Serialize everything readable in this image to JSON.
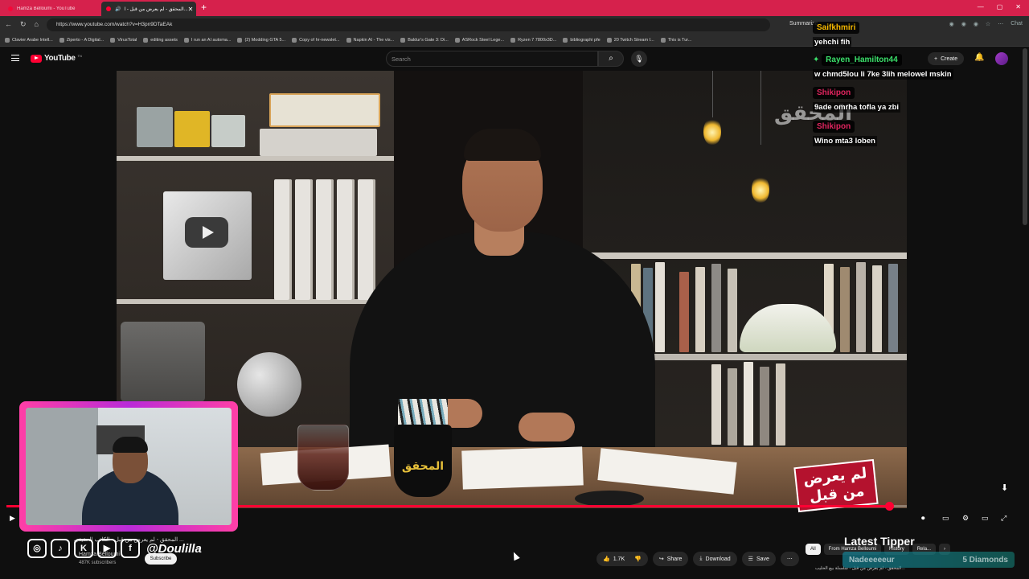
{
  "browser": {
    "tabs": [
      {
        "label": "Hamza Belloumi - YouTube",
        "active": false
      },
      {
        "label": "المحقق - لم يعرض من قبل - ا...",
        "active": true
      }
    ],
    "url": "https://www.youtube.com/watch?v=H3pn9DTaEAk",
    "summarize_label": "Summarize",
    "chat_label": "Chat",
    "bookmarks": [
      "Clavier Arabe Intell...",
      "Ziperto - A Digital...",
      "VirusTotal",
      "editing assets",
      "I run an AI automa...",
      "(2) Modding GTA 5...",
      "Copy of hr-newslet...",
      "Napkin AI - The vis...",
      "Baldur's Gate 3: Di...",
      "ASRock Steel Lege...",
      "Ryzen 7 7800x3D...",
      "bibliographi pfe",
      "20 Twitch Stream I...",
      "This is Tur..."
    ]
  },
  "youtube": {
    "logo_text": "YouTube",
    "country_code": "TN",
    "search_placeholder": "Search",
    "create_label": "Create"
  },
  "video": {
    "title_badge": "لم يعرض من قبل",
    "watermark": "المحقق",
    "mug_text": "المحقق",
    "progress": 0.98
  },
  "streamer": {
    "social_handle": "@Doulilla"
  },
  "below_video": {
    "title": "المحقق - لم يعرض من قبل - الكاتب الحقيقي ...",
    "channel_name": "Hamza Belloumi",
    "subscriber_count": "487K subscribers",
    "subscribe_label": "Subscribe",
    "like_count": "1.7K",
    "share_label": "Share",
    "download_label": "Download",
    "save_label": "Save"
  },
  "sidebar": {
    "chips": [
      "All",
      "From Hamza Belloumi",
      "History",
      "Rela..."
    ],
    "next_video_title": "المحقق - لم يعرض من قبل - سلسلة بيع الحليب..."
  },
  "tipper": {
    "title": "Latest Tipper",
    "name": "Nadeeeeeur",
    "amount": "5 Diamonds"
  },
  "chat": [
    {
      "user": "Saifkhmiri",
      "color": "#f5b800",
      "text": "yehchi fih"
    },
    {
      "user": "Rayen_Hamilton44",
      "color": "#3be16b",
      "text": "w chmd5lou li 7ke 3lih melowel mskin"
    },
    {
      "user": "Shikipon",
      "color": "#e0245e",
      "text": "9ade omrha tofla ya zbi"
    },
    {
      "user": "Shikipon",
      "color": "#e0245e",
      "text": "Wino mta3 loben"
    }
  ]
}
